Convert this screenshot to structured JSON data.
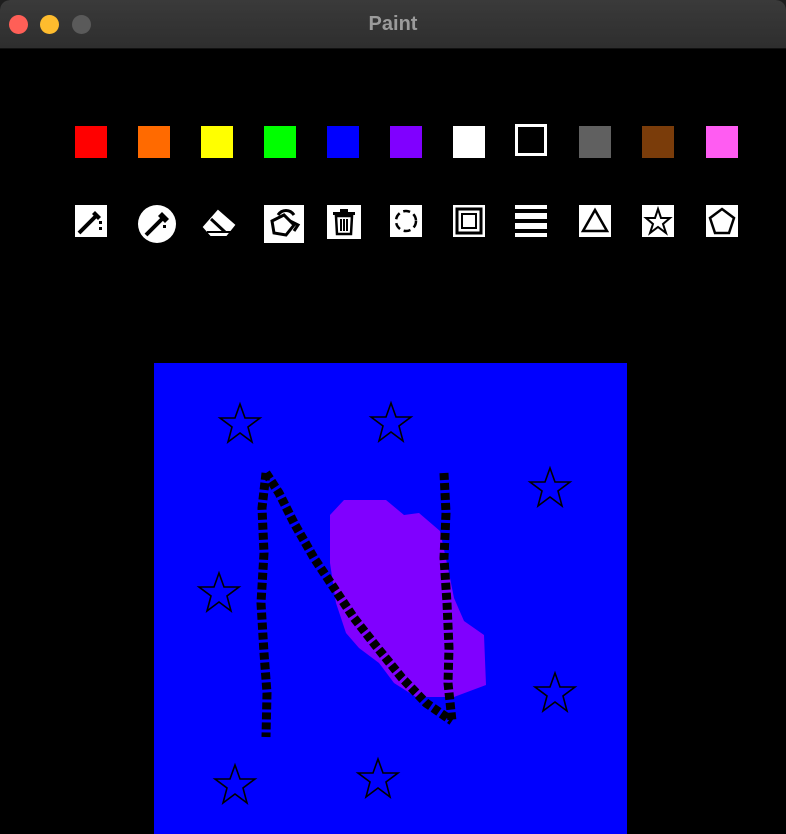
{
  "window": {
    "title": "Paint"
  },
  "palette": {
    "colors": [
      {
        "name": "red",
        "hex": "#ff0000"
      },
      {
        "name": "orange",
        "hex": "#ff6a00"
      },
      {
        "name": "yellow",
        "hex": "#ffff00"
      },
      {
        "name": "green",
        "hex": "#00ff00"
      },
      {
        "name": "blue",
        "hex": "#0000ff"
      },
      {
        "name": "purple",
        "hex": "#8000ff"
      },
      {
        "name": "white",
        "hex": "#ffffff"
      },
      {
        "name": "black",
        "hex": "#000000",
        "selected": true
      },
      {
        "name": "gray",
        "hex": "#606060"
      },
      {
        "name": "brown",
        "hex": "#7a3c0a"
      },
      {
        "name": "pink",
        "hex": "#ff5cf2"
      }
    ]
  },
  "tools": [
    "brush-icon",
    "picker-icon",
    "eraser-icon",
    "fill-bucket-icon",
    "trash-icon",
    "circle-icon",
    "square-icon",
    "rectangle-icon",
    "triangle-icon",
    "star-icon",
    "pentagon-icon"
  ],
  "canvas": {
    "background": "#0000ff",
    "blob_color": "#8000ff",
    "stroke_color": "#000000"
  }
}
